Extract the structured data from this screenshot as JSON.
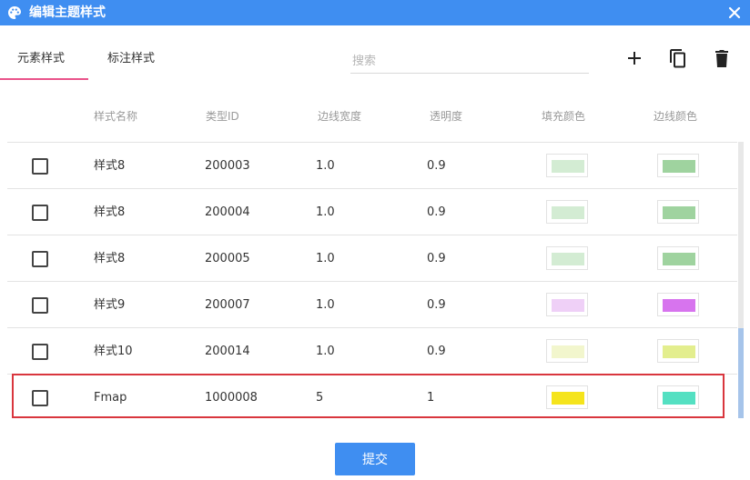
{
  "window": {
    "title": "编辑主题样式"
  },
  "tabs": [
    {
      "label": "元素样式",
      "active": true
    },
    {
      "label": "标注样式",
      "active": false
    }
  ],
  "search": {
    "placeholder": "搜索"
  },
  "toolbar": {
    "icons": [
      "add-icon",
      "copy-icon",
      "delete-icon"
    ]
  },
  "table": {
    "headers": [
      "样式名称",
      "类型ID",
      "边线宽度",
      "透明度",
      "填充颜色",
      "边线颜色"
    ],
    "rows": [
      {
        "name": "样式8",
        "type_id": "200003",
        "border_width": "1.0",
        "opacity": "0.9",
        "fill": "#d3ecd3",
        "stroke": "#9fd39f"
      },
      {
        "name": "样式8",
        "type_id": "200004",
        "border_width": "1.0",
        "opacity": "0.9",
        "fill": "#d3ecd3",
        "stroke": "#9fd39f"
      },
      {
        "name": "样式8",
        "type_id": "200005",
        "border_width": "1.0",
        "opacity": "0.9",
        "fill": "#d3ecd3",
        "stroke": "#9fd39f"
      },
      {
        "name": "样式9",
        "type_id": "200007",
        "border_width": "1.0",
        "opacity": "0.9",
        "fill": "#efd0f7",
        "stroke": "#d774ee"
      },
      {
        "name": "样式10",
        "type_id": "200014",
        "border_width": "1.0",
        "opacity": "0.9",
        "fill": "#f2f6cd",
        "stroke": "#e3ee8e"
      },
      {
        "name": "Fmap",
        "type_id": "1000008",
        "border_width": "5",
        "opacity": "1",
        "fill": "#f5e41c",
        "stroke": "#54e0c2"
      }
    ]
  },
  "footer": {
    "submit_label": "提交"
  },
  "colors": {
    "accent": "#3f8ef1",
    "tab_underline": "#e9538a",
    "highlight": "#d9363e"
  }
}
